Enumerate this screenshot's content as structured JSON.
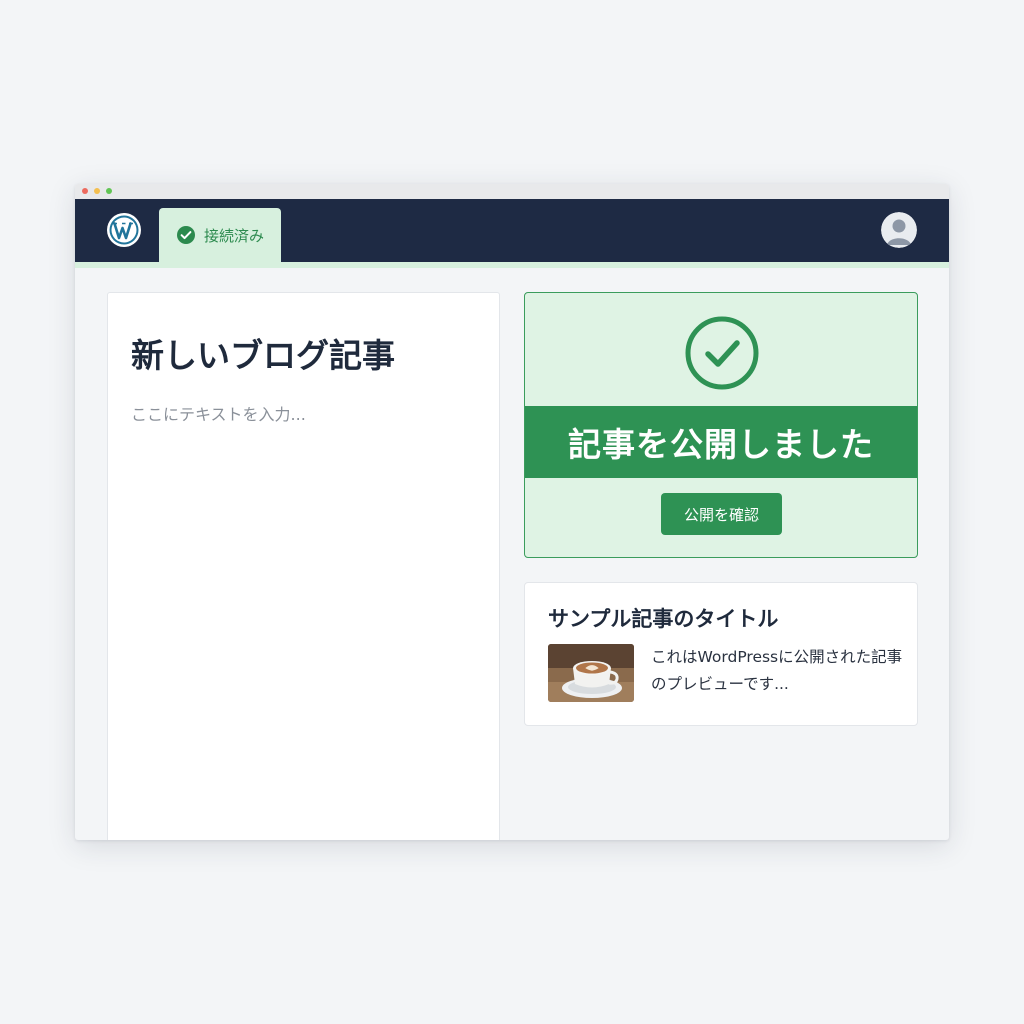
{
  "header": {
    "logo_icon": "wordpress-logo-icon",
    "status_tab": {
      "label": "接続済み",
      "icon": "check-circle-icon"
    },
    "avatar_icon": "user-avatar-icon"
  },
  "editor": {
    "title": "新しいブログ記事",
    "body_placeholder": "ここにテキストを入力..."
  },
  "publish_notice": {
    "icon": "check-circle-icon",
    "message": "記事を公開しました",
    "button_label": "公開を確認"
  },
  "post_preview": {
    "title": "サンプル記事のタイトル",
    "thumbnail": "latte-coffee-cup-image",
    "excerpt": "これはWordPressに公開された記事のプレビューです..."
  },
  "colors": {
    "topbar": "#1e2a44",
    "accent_green": "#2e9254",
    "light_green": "#dff3e4",
    "connected_tab": "#d7f0de"
  }
}
